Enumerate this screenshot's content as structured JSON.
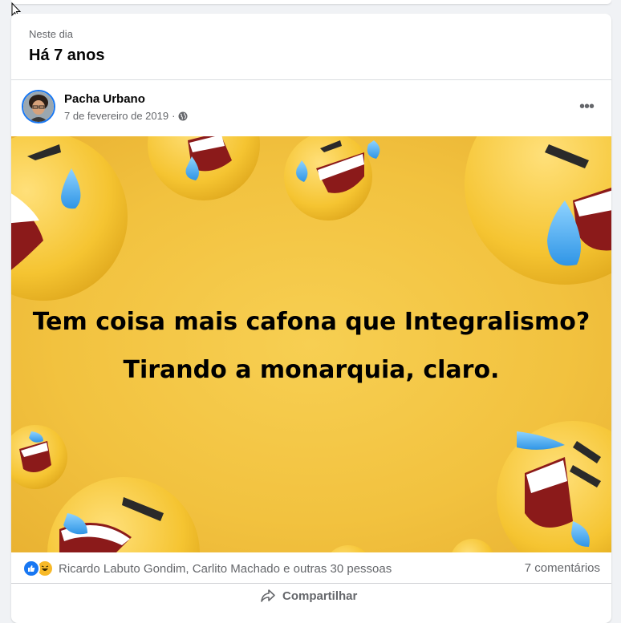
{
  "memory": {
    "label": "Neste dia",
    "title": "Há 7 anos"
  },
  "post": {
    "author": "Pacha Urbano",
    "date": "7 de fevereiro de 2019",
    "separator": "·",
    "privacy_icon": "globe-icon",
    "more_icon": "more-options-icon",
    "image": {
      "background_color": "#f2c23f",
      "line1": "Tem coisa mais cafona que Integralismo?",
      "line2": "Tirando a monarquia, claro."
    }
  },
  "reactions": {
    "icons": [
      "like-icon",
      "haha-icon"
    ],
    "text": "Ricardo Labuto Gondim, Carlito Machado e outras 30 pessoas",
    "comments": "7 comentários"
  },
  "actions": {
    "share_label": "Compartilhar"
  },
  "colors": {
    "accent": "#1877f2",
    "muted_text": "#65676b",
    "page_bg": "#f0f2f5"
  }
}
